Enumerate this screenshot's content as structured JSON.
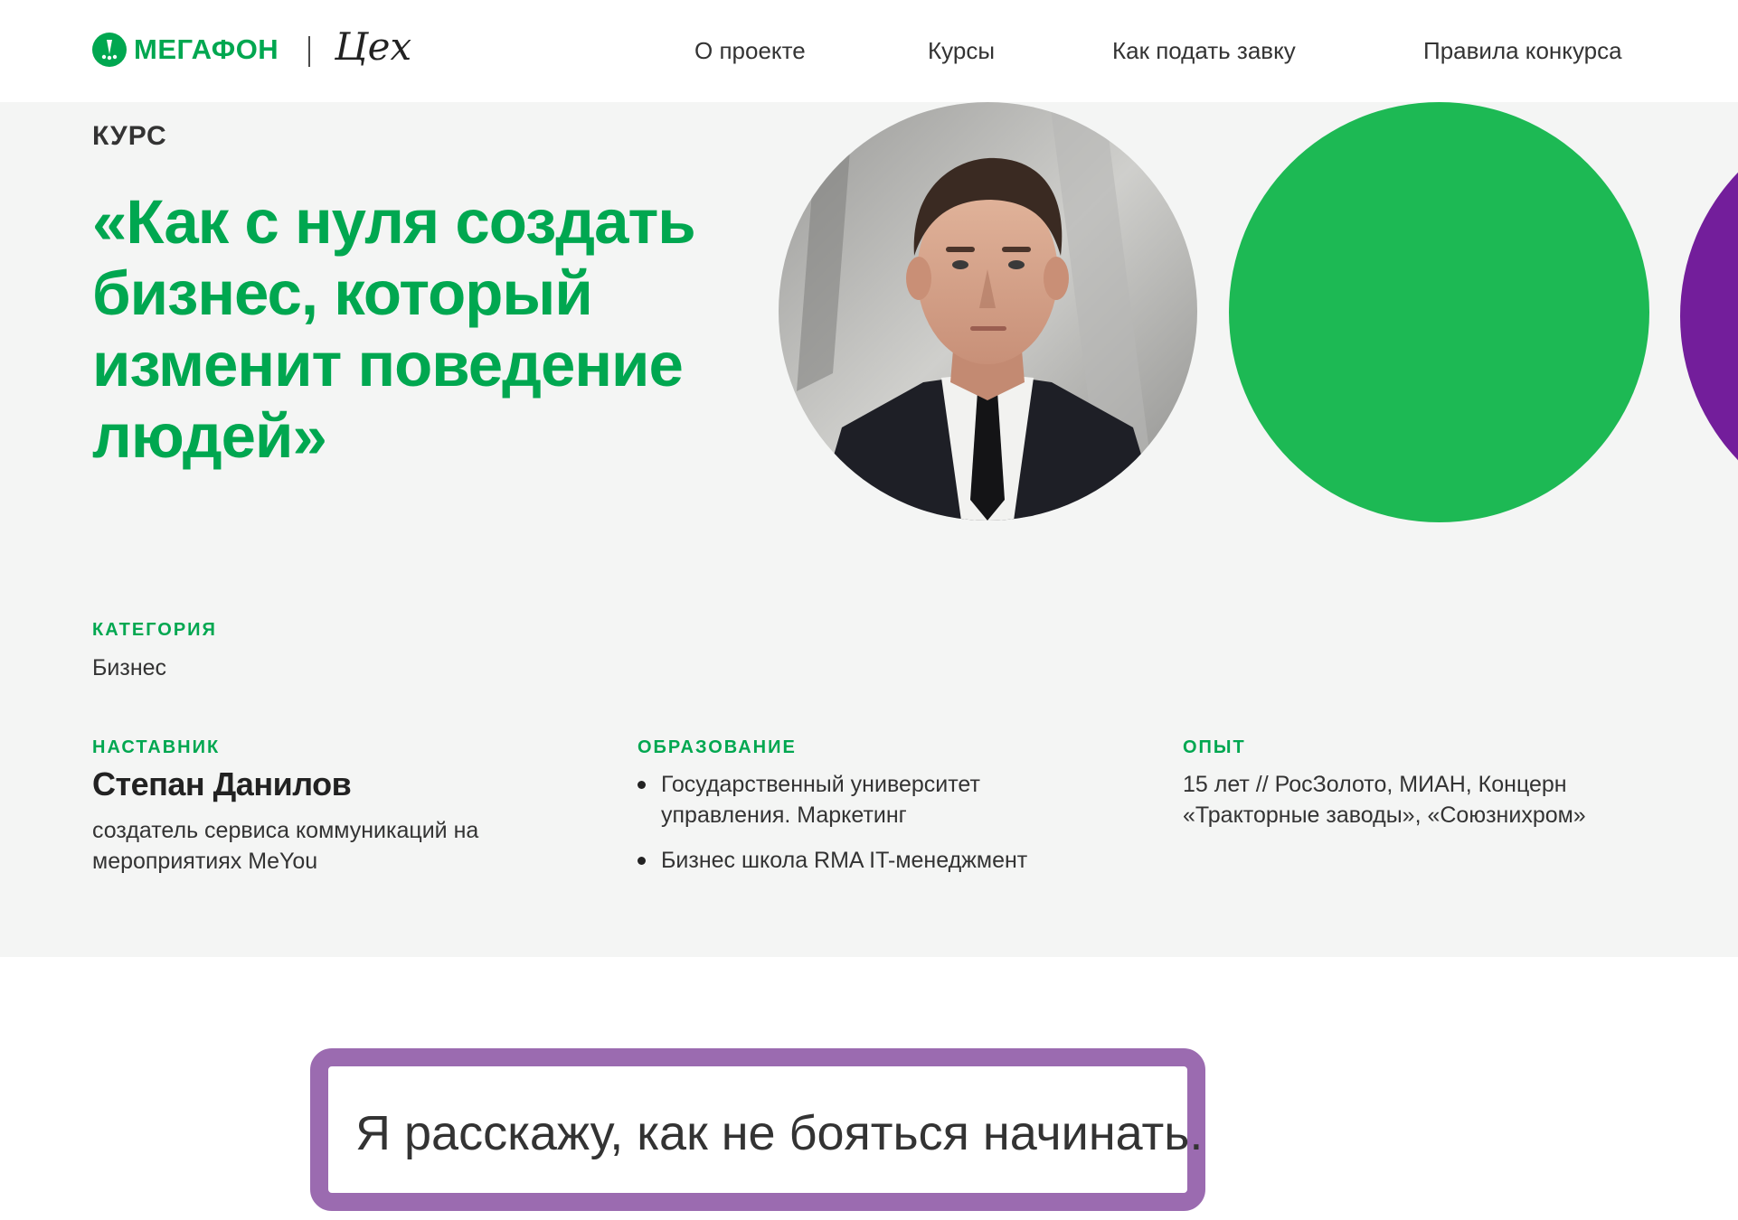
{
  "header": {
    "brand_name": "МегаФон",
    "partner_logo_text": "Цех",
    "nav": [
      {
        "label": "О проекте"
      },
      {
        "label": "Курсы"
      },
      {
        "label": "Как подать завку"
      },
      {
        "label": "Правила конкурса"
      }
    ]
  },
  "course": {
    "label": "КУРС",
    "title": "«Как с нуля создать бизнес, который изменит поведение людей»",
    "category_label": "КАТЕГОРИЯ",
    "category_value": "Бизнес"
  },
  "mentor": {
    "label": "НАСТАВНИК",
    "name": "Степан Данилов",
    "role": "создатель сервиса коммуникаций на мероприятиях MeYou"
  },
  "education": {
    "label": "ОБРАЗОВАНИЕ",
    "items": [
      "Государственный университет управления. Маркетинг",
      "Бизнес школа RMA IT-менеджмент"
    ]
  },
  "experience": {
    "label": "ОПЫТ",
    "text": "15 лет // РосЗолото, МИАН, Концерн «Тракторные заводы», «Союзнихром»"
  },
  "quote": {
    "text": "Я расскажу, как не бояться начинать."
  },
  "colors": {
    "brand_green": "#00a750",
    "circle_green": "#1db954",
    "accent_purple": "#731e9b",
    "quote_border": "#9b6bb0",
    "hero_bg": "#f4f5f4"
  },
  "icons": {
    "brand_mark": "megafon-logo-icon",
    "partner_logo": "tseh-logo-icon"
  }
}
